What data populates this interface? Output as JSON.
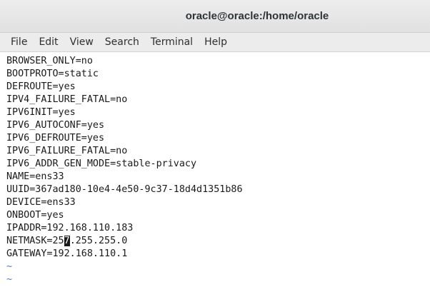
{
  "window": {
    "title": "oracle@oracle:/home/oracle"
  },
  "menu": {
    "items": [
      "File",
      "Edit",
      "View",
      "Search",
      "Terminal",
      "Help"
    ]
  },
  "terminal": {
    "lines": [
      "BROWSER_ONLY=no",
      "BOOTPROTO=static",
      "DEFROUTE=yes",
      "IPV4_FAILURE_FATAL=no",
      "IPV6INIT=yes",
      "IPV6_AUTOCONF=yes",
      "IPV6_DEFROUTE=yes",
      "IPV6_FAILURE_FATAL=no",
      "IPV6_ADDR_GEN_MODE=stable-privacy",
      "NAME=ens33",
      "UUID=367ad180-10e4-4e50-9c37-18d4d1351b86",
      "DEVICE=ens33",
      "ONBOOT=yes",
      "IPADDR=192.168.110.183"
    ],
    "netmask_prefix": "NETMASK=25",
    "netmask_cursor_char": "7",
    "netmask_suffix": ".255.255.0",
    "gateway_line": "GATEWAY=192.168.110.1",
    "tilde_lines": [
      "~",
      "~"
    ]
  }
}
